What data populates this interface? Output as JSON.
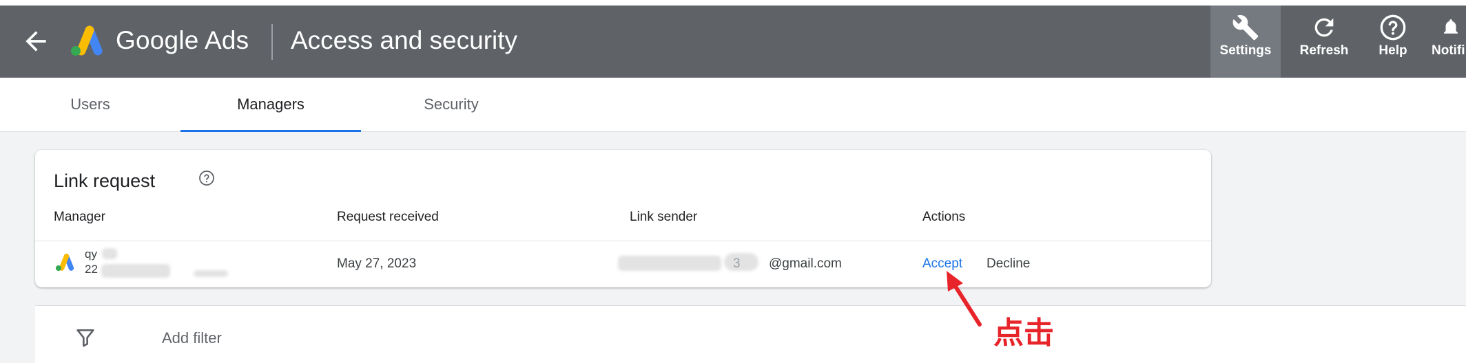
{
  "header": {
    "back_label": "Back",
    "brand": "Google Ads",
    "title": "Access and security",
    "tools": [
      {
        "label": "Settings",
        "icon": "wrench-icon",
        "active": true
      },
      {
        "label": "Refresh",
        "icon": "refresh-icon",
        "active": false
      },
      {
        "label": "Help",
        "icon": "help-icon",
        "active": false
      },
      {
        "label": "Notifi",
        "icon": "notifications-icon",
        "active": false
      }
    ]
  },
  "tabs": [
    {
      "label": "Users",
      "active": false
    },
    {
      "label": "Managers",
      "active": true
    },
    {
      "label": "Security",
      "active": false
    }
  ],
  "link_request": {
    "title": "Link request",
    "columns": [
      "Manager",
      "Request received",
      "Link sender",
      "Actions"
    ],
    "row": {
      "manager_name": "qy",
      "manager_id": "22",
      "received": "May 27, 2023",
      "sender": "@gmail.com",
      "accept_label": "Accept",
      "decline_label": "Decline"
    }
  },
  "filter": {
    "label": "Add filter"
  },
  "annotation": {
    "text": "点击"
  },
  "colors": {
    "header_bg": "#5f6368",
    "accent": "#1a73e8",
    "annotation": "#e8242b",
    "logo_blue": "#4285f4",
    "logo_yellow": "#fbbc04",
    "logo_green": "#34a853"
  }
}
